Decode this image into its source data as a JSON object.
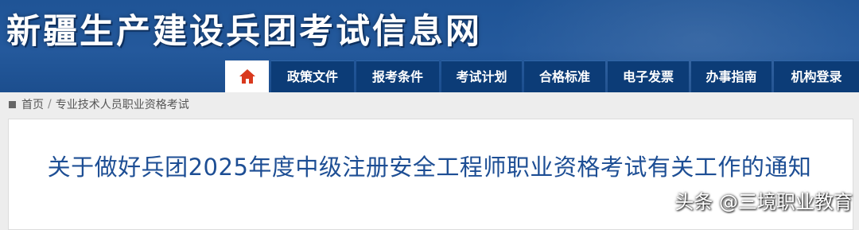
{
  "site": {
    "title": "新疆生产建设兵团考试信息网"
  },
  "nav": {
    "home_icon": "home-icon",
    "items": [
      "政策文件",
      "报考条件",
      "考试计划",
      "合格标准",
      "电子发票",
      "办事指南",
      "机构登录"
    ]
  },
  "breadcrumb": {
    "items": [
      "首页",
      "专业技术人员职业资格考试"
    ],
    "separator": "/"
  },
  "article": {
    "title": "关于做好兵团2025年度中级注册安全工程师职业资格考试有关工作的通知"
  },
  "watermark": {
    "text": "头条 @三境职业教育"
  },
  "colors": {
    "header": "#1f5496",
    "nav": "#0c3c77",
    "home_icon": "#d9391d",
    "title": "#1d4e94"
  }
}
